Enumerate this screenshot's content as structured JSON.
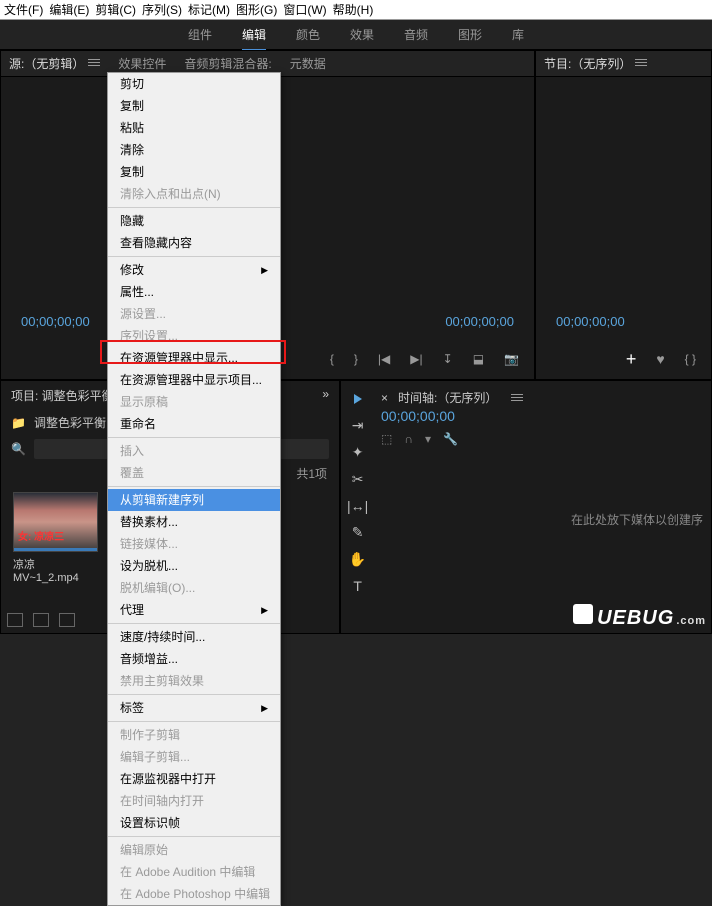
{
  "menubar": {
    "file": "文件(F)",
    "edit": "编辑(E)",
    "clip": "剪辑(C)",
    "sequence": "序列(S)",
    "marker": "标记(M)",
    "graphics": "图形(G)",
    "window": "窗口(W)",
    "help": "帮助(H)"
  },
  "top_tabs": {
    "assembly": "组件",
    "editing": "编辑",
    "color": "颜色",
    "effects": "效果",
    "audio": "音频",
    "graphics": "图形",
    "library": "库"
  },
  "source_panel": {
    "title": "源:（无剪辑）",
    "tab2": "效果控件",
    "tab3": "音频剪辑混合器:",
    "tab4": "元数据",
    "tc_left": "00;00;00;00",
    "tc_right": "00;00;00;00"
  },
  "program_panel": {
    "title": "节目:（无序列）",
    "tc_left": "00;00;00;00",
    "plus": "+",
    "braces": "{  }"
  },
  "project_panel": {
    "title": "项目: 调整色彩平衡",
    "close": "×",
    "chevrons": "»",
    "bin": "调整色彩平衡",
    "search_placeholder": "",
    "count": "共1项",
    "thumb_red": "女: 凉凉三",
    "thumb_name": "凉凉MV~1_2.mp4"
  },
  "timeline_panel": {
    "title": "时间轴:（无序列）",
    "close": "×",
    "tc": "00;00;00;00",
    "message": "在此处放下媒体以创建序"
  },
  "context_menu": {
    "items": [
      {
        "label": "剪切",
        "disabled": false
      },
      {
        "label": "复制",
        "disabled": false
      },
      {
        "label": "粘贴",
        "disabled": false
      },
      {
        "label": "清除",
        "disabled": false
      },
      {
        "label": "复制",
        "disabled": false
      },
      {
        "label": "清除入点和出点(N)",
        "disabled": true
      },
      {
        "sep": true
      },
      {
        "label": "隐藏",
        "disabled": false
      },
      {
        "label": "查看隐藏内容",
        "disabled": false
      },
      {
        "sep": true
      },
      {
        "label": "修改",
        "disabled": false,
        "arrow": true
      },
      {
        "label": "属性...",
        "disabled": false
      },
      {
        "label": "源设置...",
        "disabled": true
      },
      {
        "label": "序列设置...",
        "disabled": true
      },
      {
        "label": "在资源管理器中显示...",
        "disabled": false
      },
      {
        "label": "在资源管理器中显示项目...",
        "disabled": false
      },
      {
        "label": "显示原稿",
        "disabled": true
      },
      {
        "label": "重命名",
        "disabled": false
      },
      {
        "sep": true
      },
      {
        "label": "插入",
        "disabled": true
      },
      {
        "label": "覆盖",
        "disabled": true
      },
      {
        "sep": true
      },
      {
        "label": "从剪辑新建序列",
        "disabled": false,
        "highlight": true
      },
      {
        "label": "替换素材...",
        "disabled": false
      },
      {
        "label": "链接媒体...",
        "disabled": true
      },
      {
        "label": "设为脱机...",
        "disabled": false
      },
      {
        "label": "脱机编辑(O)...",
        "disabled": true
      },
      {
        "label": "代理",
        "disabled": false,
        "arrow": true
      },
      {
        "sep": true
      },
      {
        "label": "速度/持续时间...",
        "disabled": false
      },
      {
        "label": "音频增益...",
        "disabled": false
      },
      {
        "label": "禁用主剪辑效果",
        "disabled": true
      },
      {
        "sep": true
      },
      {
        "label": "标签",
        "disabled": false,
        "arrow": true
      },
      {
        "sep": true
      },
      {
        "label": "制作子剪辑",
        "disabled": true
      },
      {
        "label": "编辑子剪辑...",
        "disabled": true
      },
      {
        "label": "在源监视器中打开",
        "disabled": false
      },
      {
        "label": "在时间轴内打开",
        "disabled": true
      },
      {
        "label": "设置标识帧",
        "disabled": false
      },
      {
        "sep": true
      },
      {
        "label": "编辑原始",
        "disabled": true
      },
      {
        "label": "在 Adobe Audition 中编辑",
        "disabled": true
      },
      {
        "label": "在 Adobe Photoshop 中编辑",
        "disabled": true
      }
    ]
  },
  "watermark": {
    "text": "UEBUG",
    "suffix": ".com"
  }
}
